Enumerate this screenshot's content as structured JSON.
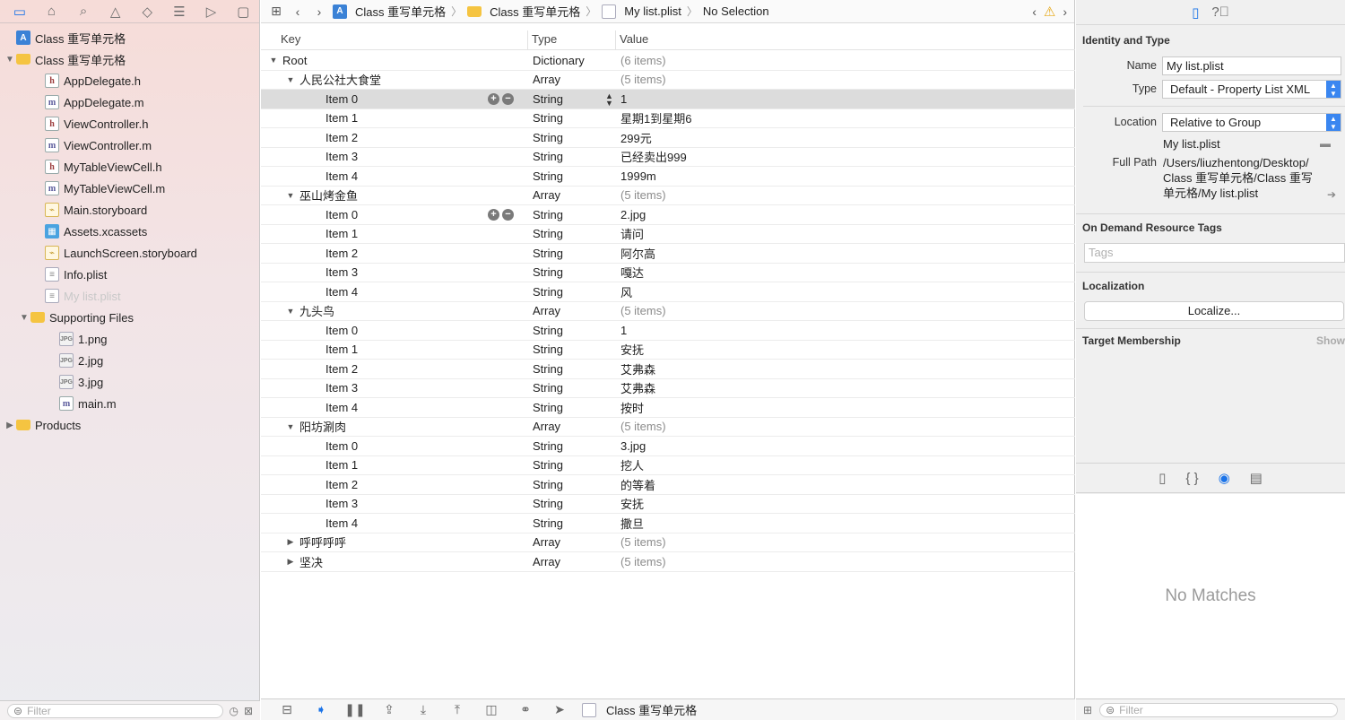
{
  "navigator": {
    "toolbar_icons": [
      "folder-icon",
      "hierarchy-icon",
      "search-icon",
      "warning-icon",
      "test-icon",
      "debug-icon",
      "breakpoint-icon",
      "report-icon"
    ],
    "tree": [
      {
        "label": "Class 重写单元格",
        "icon": "proj",
        "indent": 0,
        "disclosure": ""
      },
      {
        "label": "Class 重写单元格",
        "icon": "folder",
        "indent": 0,
        "disclosure": "open"
      },
      {
        "label": "AppDelegate.h",
        "icon": "h",
        "indent": 2,
        "disclosure": ""
      },
      {
        "label": "AppDelegate.m",
        "icon": "m",
        "indent": 2,
        "disclosure": ""
      },
      {
        "label": "ViewController.h",
        "icon": "h",
        "indent": 2,
        "disclosure": ""
      },
      {
        "label": "ViewController.m",
        "icon": "m",
        "indent": 2,
        "disclosure": ""
      },
      {
        "label": "MyTableViewCell.h",
        "icon": "h",
        "indent": 2,
        "disclosure": ""
      },
      {
        "label": "MyTableViewCell.m",
        "icon": "m",
        "indent": 2,
        "disclosure": ""
      },
      {
        "label": "Main.storyboard",
        "icon": "sb",
        "indent": 2,
        "disclosure": ""
      },
      {
        "label": "Assets.xcassets",
        "icon": "xc",
        "indent": 2,
        "disclosure": ""
      },
      {
        "label": "LaunchScreen.storyboard",
        "icon": "sb",
        "indent": 2,
        "disclosure": ""
      },
      {
        "label": "Info.plist",
        "icon": "pl",
        "indent": 2,
        "disclosure": ""
      },
      {
        "label": "My list.plist",
        "icon": "pl",
        "indent": 2,
        "disclosure": "",
        "dim": true
      },
      {
        "label": "Supporting Files",
        "icon": "folder",
        "indent": 1,
        "disclosure": "open"
      },
      {
        "label": "1.png",
        "icon": "img",
        "indent": 3,
        "disclosure": ""
      },
      {
        "label": "2.jpg",
        "icon": "img",
        "indent": 3,
        "disclosure": ""
      },
      {
        "label": "3.jpg",
        "icon": "img",
        "indent": 3,
        "disclosure": ""
      },
      {
        "label": "main.m",
        "icon": "m",
        "indent": 3,
        "disclosure": ""
      },
      {
        "label": "Products",
        "icon": "folder",
        "indent": 0,
        "disclosure": "closed"
      }
    ],
    "filter_placeholder": "Filter"
  },
  "jumpbar": {
    "crumbs": [
      "Class 重写单元格",
      "Class 重写单元格",
      "My list.plist",
      "No Selection"
    ]
  },
  "plist": {
    "headers": {
      "key": "Key",
      "type": "Type",
      "value": "Value"
    },
    "rows": [
      {
        "key": "Root",
        "type": "Dictionary",
        "value": "(6 items)",
        "level": 0,
        "disclosure": "open",
        "dim": true
      },
      {
        "key": "人民公社大食堂",
        "type": "Array",
        "value": "(5 items)",
        "level": 1,
        "disclosure": "open",
        "dim": true
      },
      {
        "key": "Item 0",
        "type": "String",
        "value": "1",
        "level": 2,
        "selected": true,
        "controls": true
      },
      {
        "key": "Item 1",
        "type": "String",
        "value": "星期1到星期6",
        "level": 2
      },
      {
        "key": "Item 2",
        "type": "String",
        "value": "299元",
        "level": 2
      },
      {
        "key": "Item 3",
        "type": "String",
        "value": "已经卖出999",
        "level": 2
      },
      {
        "key": "Item 4",
        "type": "String",
        "value": "1999m",
        "level": 2
      },
      {
        "key": "巫山烤金鱼",
        "type": "Array",
        "value": "(5 items)",
        "level": 1,
        "disclosure": "open",
        "dim": true
      },
      {
        "key": "Item 0",
        "type": "String",
        "value": "2.jpg",
        "level": 2,
        "controls": true
      },
      {
        "key": "Item 1",
        "type": "String",
        "value": "请问",
        "level": 2
      },
      {
        "key": "Item 2",
        "type": "String",
        "value": "阿尔高",
        "level": 2
      },
      {
        "key": "Item 3",
        "type": "String",
        "value": "嘎达",
        "level": 2
      },
      {
        "key": "Item 4",
        "type": "String",
        "value": "风",
        "level": 2
      },
      {
        "key": "九头鸟",
        "type": "Array",
        "value": "(5 items)",
        "level": 1,
        "disclosure": "open",
        "dim": true
      },
      {
        "key": "Item 0",
        "type": "String",
        "value": "1",
        "level": 2
      },
      {
        "key": "Item 1",
        "type": "String",
        "value": "安抚",
        "level": 2
      },
      {
        "key": "Item 2",
        "type": "String",
        "value": "艾弗森",
        "level": 2
      },
      {
        "key": "Item 3",
        "type": "String",
        "value": "艾弗森",
        "level": 2
      },
      {
        "key": "Item 4",
        "type": "String",
        "value": "按时",
        "level": 2
      },
      {
        "key": "阳坊涮肉",
        "type": "Array",
        "value": "(5 items)",
        "level": 1,
        "disclosure": "open",
        "dim": true
      },
      {
        "key": "Item 0",
        "type": "String",
        "value": "3.jpg",
        "level": 2
      },
      {
        "key": "Item 1",
        "type": "String",
        "value": "挖人",
        "level": 2
      },
      {
        "key": "Item 2",
        "type": "String",
        "value": "的等着",
        "level": 2
      },
      {
        "key": "Item 3",
        "type": "String",
        "value": "安抚",
        "level": 2
      },
      {
        "key": "Item 4",
        "type": "String",
        "value": "撒旦",
        "level": 2
      },
      {
        "key": "呼呼呼呼",
        "type": "Array",
        "value": "(5 items)",
        "level": 1,
        "disclosure": "closed",
        "dim": true
      },
      {
        "key": "坚决",
        "type": "Array",
        "value": "(5 items)",
        "level": 1,
        "disclosure": "closed",
        "dim": true
      }
    ]
  },
  "editor_bottom": {
    "target_label": "Class 重写单元格"
  },
  "inspector": {
    "identity_title": "Identity and Type",
    "name_label": "Name",
    "name_value": "My list.plist",
    "type_label": "Type",
    "type_value": "Default - Property List XML",
    "location_label": "Location",
    "location_value": "Relative to Group",
    "location_file": "My list.plist",
    "fullpath_label": "Full Path",
    "fullpath_value": "/Users/liuzhentong/Desktop/ Class 重写单元格/Class 重写 单元格/My list.plist",
    "odr_title": "On Demand Resource Tags",
    "tags_placeholder": "Tags",
    "localization_title": "Localization",
    "localize_button": "Localize...",
    "target_title": "Target Membership",
    "target_show": "Show",
    "library_empty": "No Matches",
    "filter_placeholder": "Filter"
  },
  "colors": {
    "accent": "#1a73e8",
    "selected_row": "#dcdcdc",
    "select_arrow": "#3a86f0"
  }
}
